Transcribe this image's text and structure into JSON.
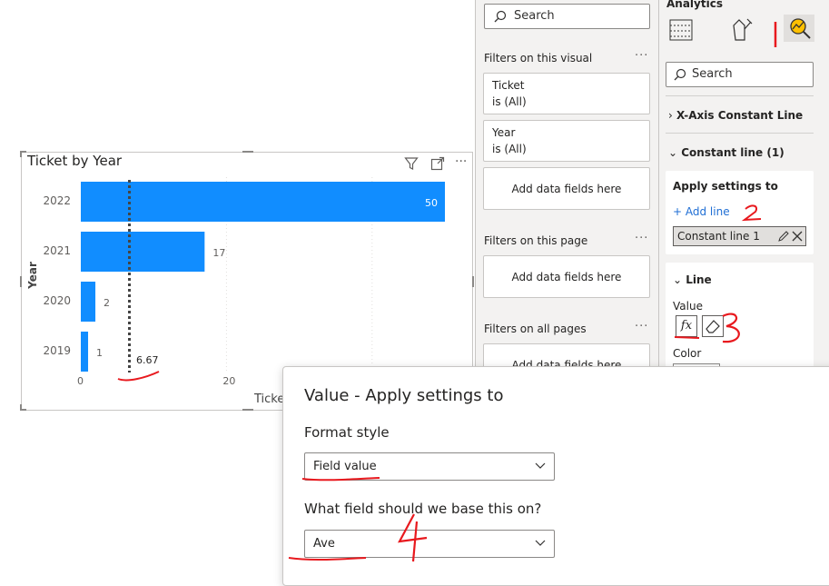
{
  "chart": {
    "title": "Ticket by Year",
    "y_axis_title": "Year",
    "x_axis_title_partial": "Ticke",
    "average_label": "6.67"
  },
  "chart_data": {
    "type": "bar",
    "title": "Ticket by Year",
    "ylabel": "Year",
    "xlabel": "Ticket",
    "categories": [
      "2022",
      "2021",
      "2020",
      "2019"
    ],
    "values": [
      50,
      17,
      2,
      1
    ],
    "x_ticks": [
      "0",
      "20"
    ],
    "xlim": [
      0,
      50
    ],
    "constant_line": 6.67,
    "bar_color": "#118dff"
  },
  "filters": {
    "search_placeholder": "Search",
    "on_visual_title": "Filters on this visual",
    "on_page_title": "Filters on this page",
    "on_all_pages_title": "Filters on all pages",
    "more": "···",
    "cards": [
      {
        "name": "Ticket",
        "state": "is (All)"
      },
      {
        "name": "Year",
        "state": "is (All)"
      }
    ],
    "add_fields": "Add data fields here"
  },
  "analytics": {
    "tab_title": "Analytics",
    "search_placeholder": "Search",
    "x_axis_constant_line": "X-Axis Constant Line",
    "constant_line_section": "Constant line (1)",
    "apply_settings_to": "Apply settings to",
    "add_line": "+ Add line",
    "selected_line": "Constant line 1",
    "line_section": "Line",
    "value_label": "Value",
    "fx_label": "fx",
    "color_label": "Color"
  },
  "popup": {
    "title": "Value - Apply settings to",
    "format_style_label": "Format style",
    "format_style_value": "Field value",
    "field_label": "What field should we base this on?",
    "field_value": "Ave"
  },
  "annotations": {
    "marker_1": "1",
    "marker_2": "2",
    "marker_3": "3",
    "marker_4": "4",
    "color": "#e8191e"
  }
}
